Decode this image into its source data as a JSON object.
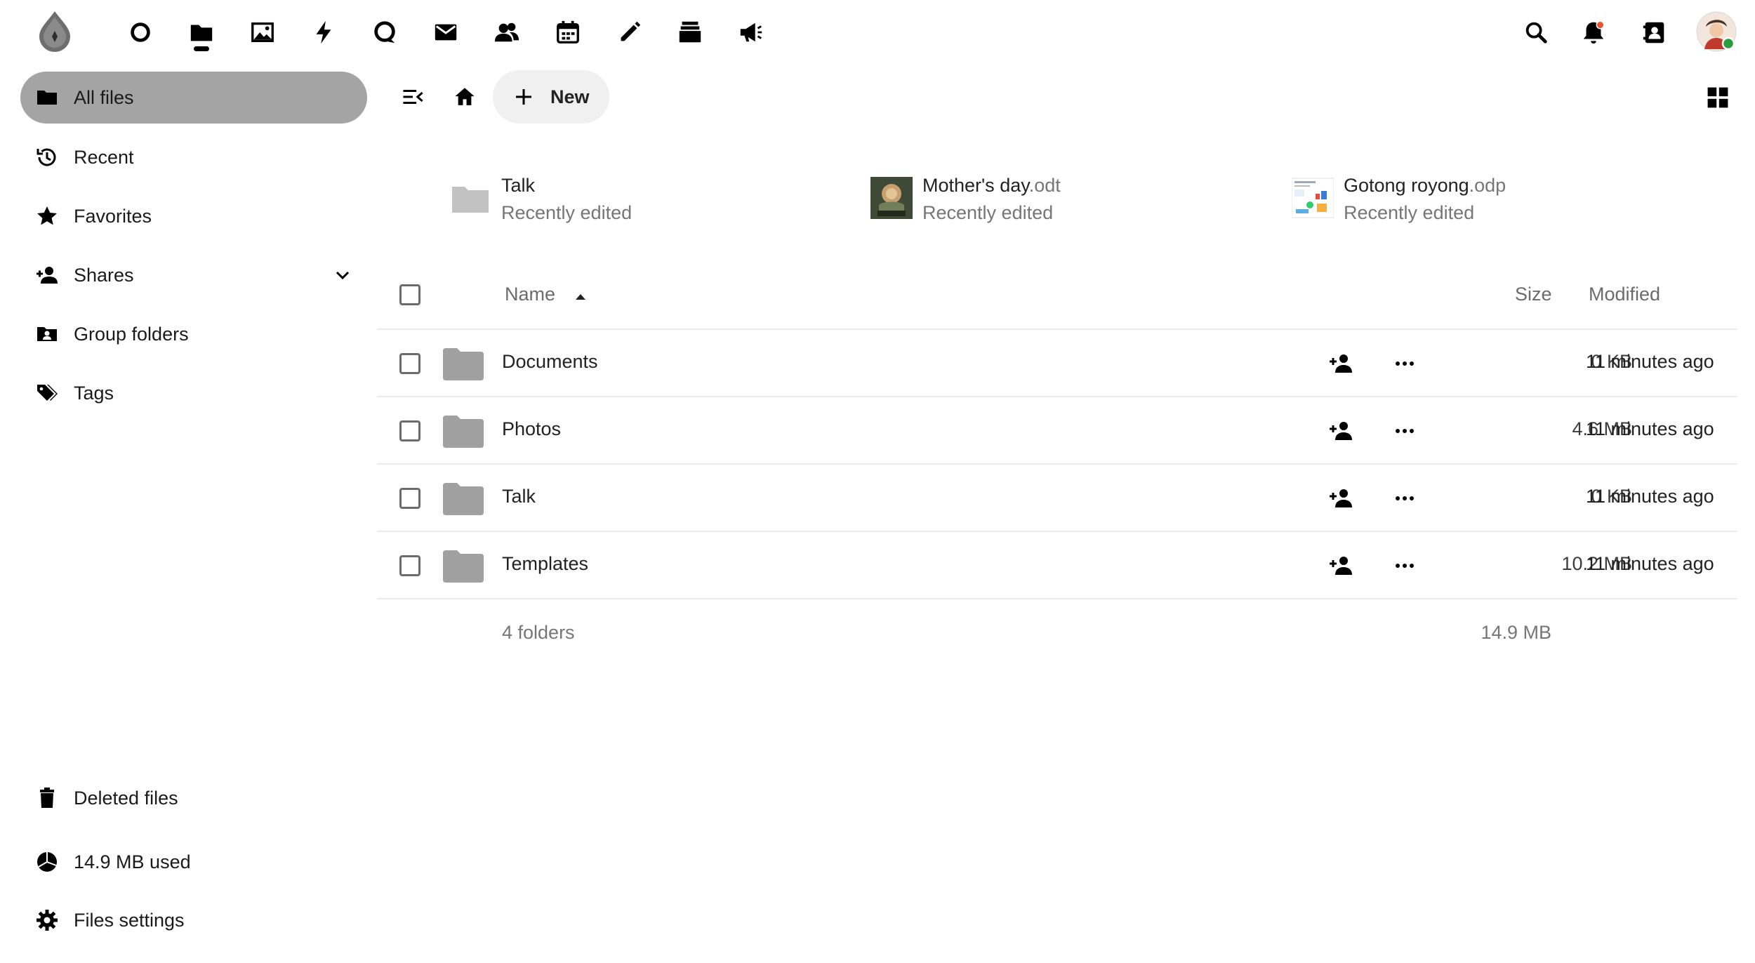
{
  "topbar": {
    "apps": [
      {
        "name": "dashboard-icon"
      },
      {
        "name": "files-icon"
      },
      {
        "name": "photos-icon"
      },
      {
        "name": "activity-icon"
      },
      {
        "name": "talk-icon"
      },
      {
        "name": "mail-icon"
      },
      {
        "name": "contacts-icon"
      },
      {
        "name": "calendar-icon"
      },
      {
        "name": "notes-icon"
      },
      {
        "name": "deck-icon"
      },
      {
        "name": "announcements-icon"
      }
    ],
    "active_app": "files",
    "right_icons": [
      "search-icon",
      "notifications-icon",
      "contacts-menu-icon",
      "avatar"
    ],
    "status_color": "#2d9c3c",
    "notification_dot_color": "#e9532b"
  },
  "sidebar": {
    "items": [
      {
        "label": "All files",
        "icon": "folder-icon",
        "active": true
      },
      {
        "label": "Recent",
        "icon": "history-icon"
      },
      {
        "label": "Favorites",
        "icon": "star-icon"
      },
      {
        "label": "Shares",
        "icon": "share-icon",
        "expandable": true
      },
      {
        "label": "Group folders",
        "icon": "group-folder-icon"
      },
      {
        "label": "Tags",
        "icon": "tag-icon"
      }
    ],
    "bottom": [
      {
        "label": "Deleted files",
        "icon": "trash-icon"
      },
      {
        "label": "14.9 MB used",
        "icon": "quota-pie-icon"
      },
      {
        "label": "Files settings",
        "icon": "gear-icon"
      }
    ]
  },
  "toolbar": {
    "new_label": "New"
  },
  "recent": [
    {
      "name": "Talk",
      "ext": "",
      "subtitle": "Recently edited",
      "kind": "folder"
    },
    {
      "name": "Mother's day",
      "ext": ".odt",
      "subtitle": "Recently edited",
      "kind": "image"
    },
    {
      "name": "Gotong royong",
      "ext": ".odp",
      "subtitle": "Recently edited",
      "kind": "slides"
    }
  ],
  "table": {
    "headers": {
      "name": "Name",
      "size": "Size",
      "modified": "Modified"
    },
    "rows": [
      {
        "name": "Documents",
        "size": "0 KB",
        "modified": "11 minutes ago"
      },
      {
        "name": "Photos",
        "size": "4.6 MB",
        "modified": "11 minutes ago"
      },
      {
        "name": "Talk",
        "size": "0 KB",
        "modified": "11 minutes ago"
      },
      {
        "name": "Templates",
        "size": "10.2 MB",
        "modified": "11 minutes ago"
      }
    ],
    "summary": {
      "count": "4 folders",
      "total": "14.9 MB"
    }
  },
  "colors": {
    "active_nav": "#a4a4a4",
    "folder": "#a0a0a0",
    "new_button_bg": "#f0f0f0"
  }
}
